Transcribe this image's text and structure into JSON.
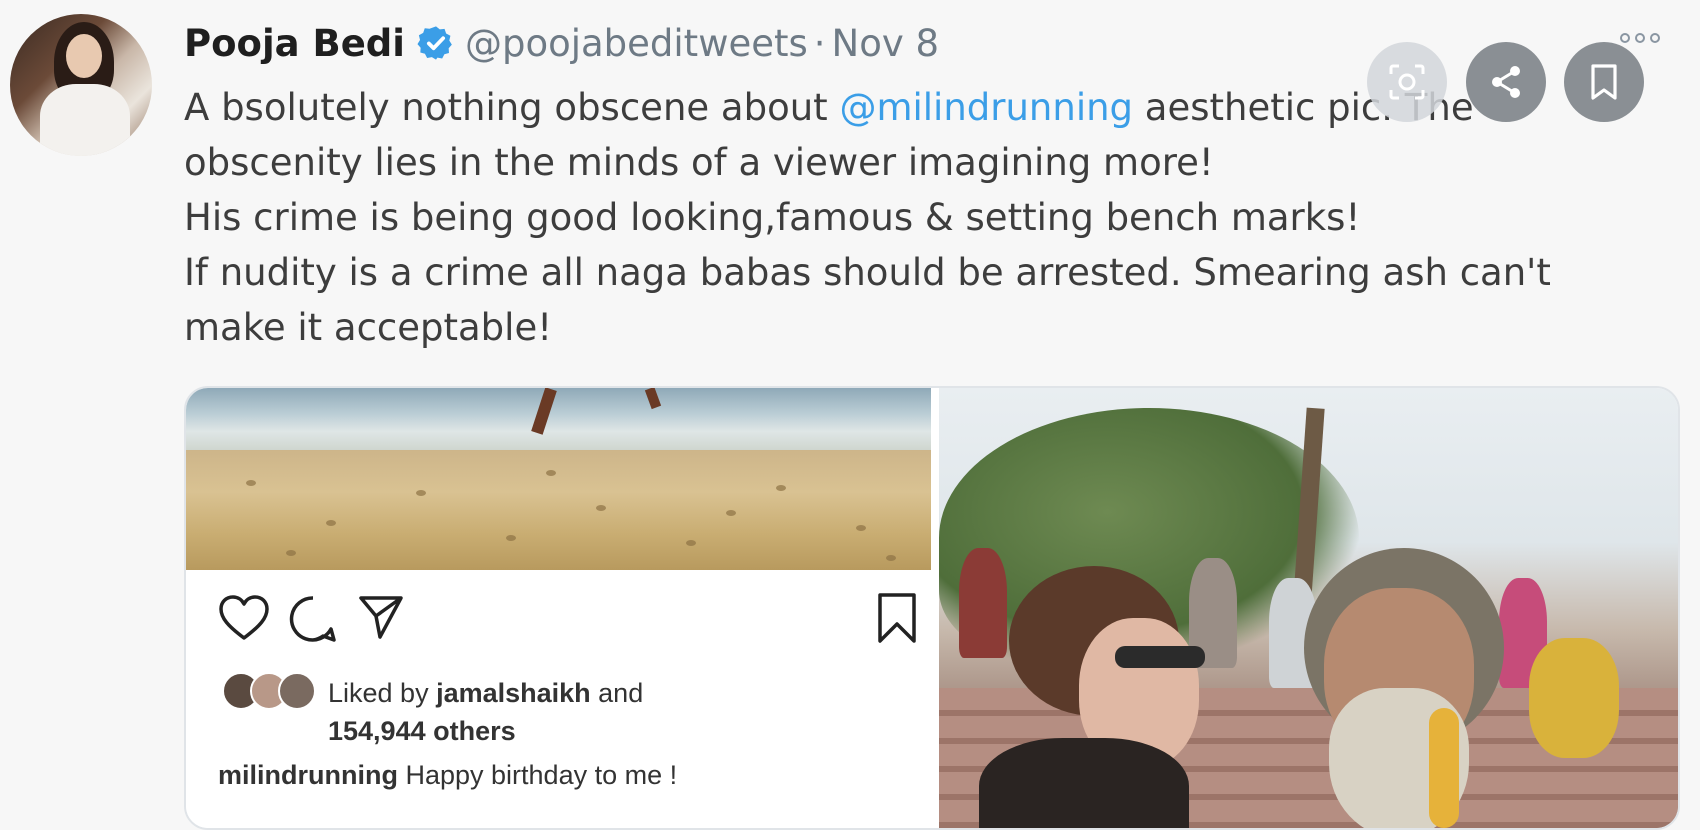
{
  "tweet": {
    "author_name": "Pooja Bedi",
    "handle": "@poojabeditweets",
    "separator": "·",
    "date": "Nov 8",
    "text": {
      "line1_before": "A bsolutely nothing obscene about ",
      "line1_mention": "@milindrunning",
      "line1_after": " aesthetic pic. The",
      "line2": "obscenity lies in the minds of a viewer imagining more!",
      "line3": "His crime is being good looking,famous & setting bench marks!",
      "line4": "If nudity is a crime all naga babas should be arrested. Smearing ash can't",
      "line5": "make it acceptable!"
    }
  },
  "instagram_embed": {
    "liked_prefix": "Liked by ",
    "liked_user": "jamalshaikh",
    "liked_and": " and",
    "liked_count": "154,944 others",
    "caption_user": "milindrunning",
    "caption_text": " Happy birthday to me !"
  },
  "icons": {
    "verified": "verified-badge-icon",
    "more": "more-options-icon",
    "heart": "heart-icon",
    "comment": "comment-icon",
    "send": "send-icon",
    "bookmark": "bookmark-icon",
    "lens": "visual-search-icon",
    "share": "share-icon",
    "save": "save-icon"
  },
  "colors": {
    "accent": "#3b9ee7",
    "verified": "#3b9ee7",
    "muted": "#6e7a85"
  }
}
